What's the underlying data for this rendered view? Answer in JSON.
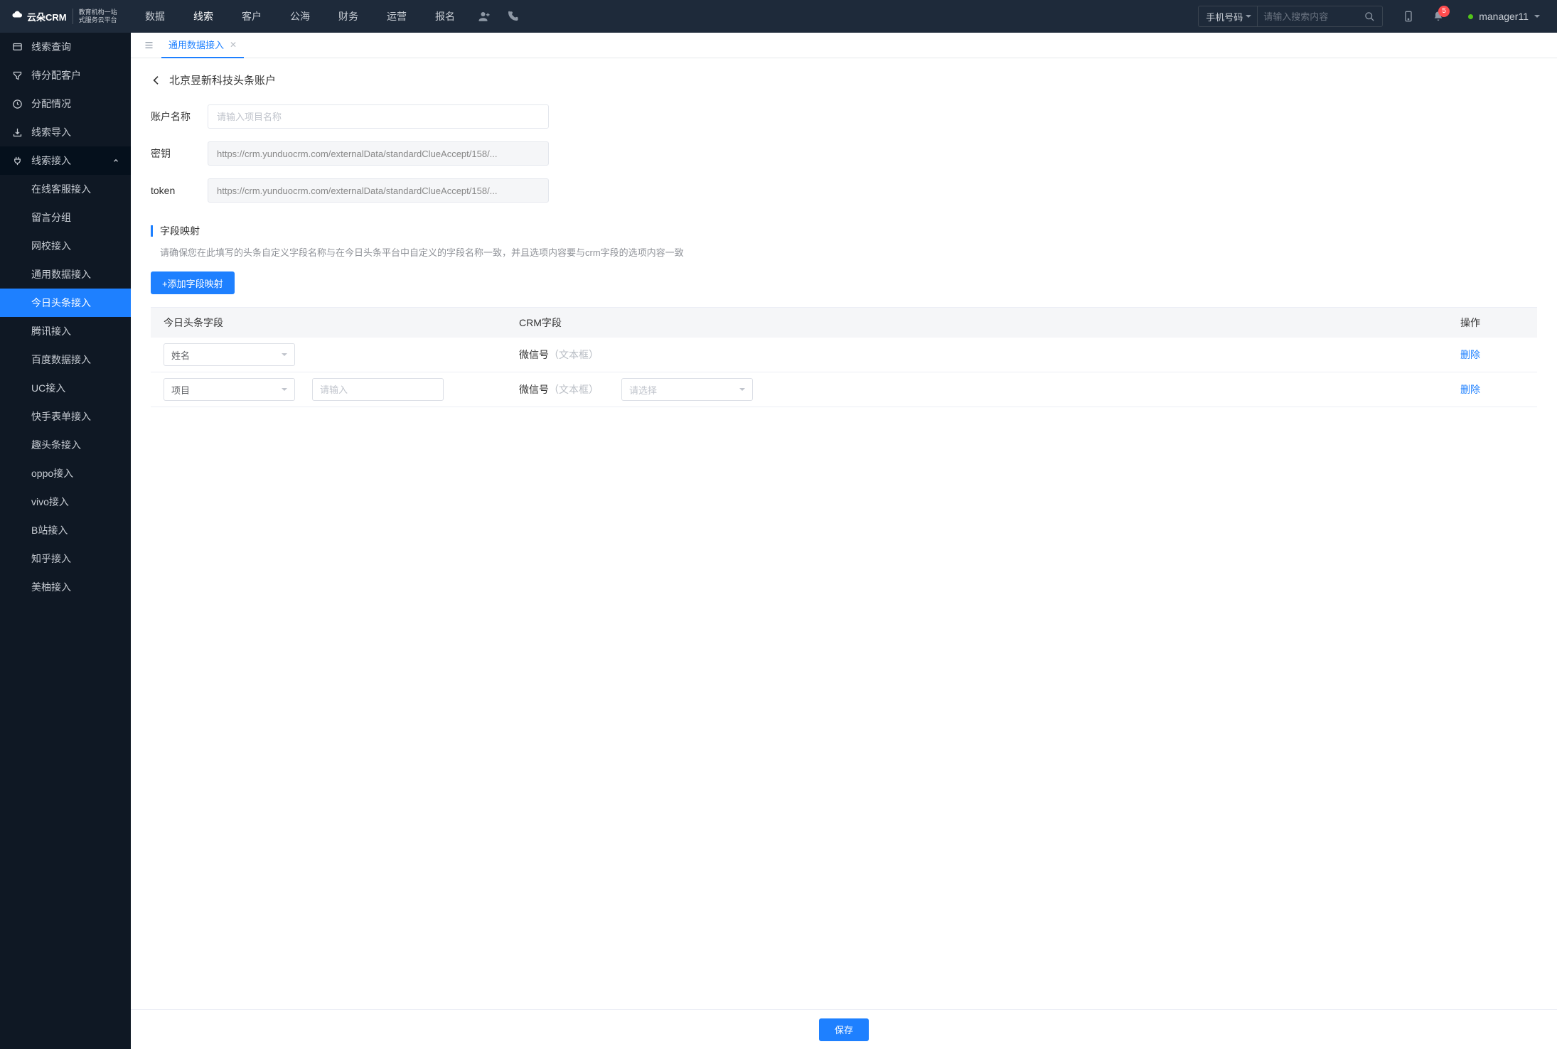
{
  "header": {
    "logo_main": "云朵CRM",
    "logo_sub1": "教育机构一站",
    "logo_sub2": "式服务云平台",
    "nav": [
      "数据",
      "线索",
      "客户",
      "公海",
      "财务",
      "运营",
      "报名"
    ],
    "nav_active_index": 1,
    "search_type": "手机号码",
    "search_placeholder": "请输入搜索内容",
    "notif_count": "5",
    "username": "manager11"
  },
  "sidebar": {
    "top": [
      {
        "label": "线索查询"
      },
      {
        "label": "待分配客户"
      },
      {
        "label": "分配情况"
      },
      {
        "label": "线索导入"
      }
    ],
    "group_label": "线索接入",
    "subs": [
      "在线客服接入",
      "留言分组",
      "网校接入",
      "通用数据接入",
      "今日头条接入",
      "腾讯接入",
      "百度数据接入",
      "UC接入",
      "快手表单接入",
      "趣头条接入",
      "oppo接入",
      "vivo接入",
      "B站接入",
      "知乎接入",
      "美柚接入"
    ],
    "active_sub_index": 4
  },
  "tabs": {
    "active_label": "通用数据接入"
  },
  "page": {
    "breadcrumb": "北京昱新科技头条账户",
    "account_name_label": "账户名称",
    "account_name_placeholder": "请输入项目名称",
    "secret_label": "密钥",
    "secret_value": "https://crm.yunduocrm.com/externalData/standardClueAccept/158/...",
    "token_label": "token",
    "token_value": "https://crm.yunduocrm.com/externalData/standardClueAccept/158/...",
    "mapping_title": "字段映射",
    "mapping_hint": "请确保您在此填写的头条自定义字段名称与在今日头条平台中自定义的字段名称一致，并且选项内容要与crm字段的选项内容一致",
    "add_mapping": "+添加字段映射",
    "table": {
      "headers": [
        "今日头条字段",
        "CRM字段",
        "操作"
      ],
      "rows": [
        {
          "tt_field": "姓名",
          "tt_input": "",
          "crm_name": "微信号",
          "crm_type": "（文本框）",
          "crm_select": "",
          "action": "删除",
          "show_input": false,
          "show_select": false
        },
        {
          "tt_field": "项目",
          "tt_input_placeholder": "请输入",
          "crm_name": "微信号",
          "crm_type": "（文本框）",
          "crm_select_placeholder": "请选择",
          "action": "删除",
          "show_input": true,
          "show_select": true
        }
      ]
    },
    "save_label": "保存"
  }
}
